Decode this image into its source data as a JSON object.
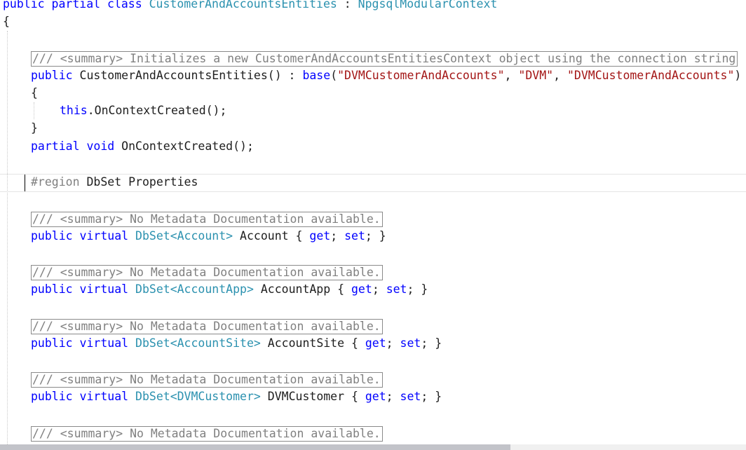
{
  "editor": {
    "lines": {
      "class_decl": {
        "kw1": "public partial class",
        "name": "CustomerAndAccountsEntities",
        "colon": " : ",
        "base": "NpgsqlModularContext"
      },
      "open_brace": "{",
      "ctor_summary": "/// <summary> Initializes a new CustomerAndAccountsEntitiesContext object using the connection string",
      "ctor_decl": {
        "kw": "public",
        "name": " CustomerAndAccountsEntities() : ",
        "base_kw": "base",
        "paren_open": "(",
        "s1": "\"DVMCustomerAndAccounts\"",
        "sep1": ", ",
        "s2": "\"DVM\"",
        "sep2": ", ",
        "s3": "\"DVMCustomerAndAccounts\"",
        "paren_close": ")"
      },
      "ctor_open": "{",
      "ctor_body": {
        "this_kw": "this",
        "rest": ".OnContextCreated();"
      },
      "ctor_close": "}",
      "partial_decl": {
        "kw": "partial void",
        "rest": " OnContextCreated();"
      },
      "region": {
        "kw": "#region",
        "rest": " DbSet Properties"
      },
      "doc_summary": "/// <summary> No Metadata Documentation available.",
      "props": [
        {
          "mods": "public virtual",
          "dbset": "DbSet",
          "lt": "<",
          "entity": "Account",
          "gt": ">",
          "name": " Account ",
          "ob": "{ ",
          "get": "get",
          "semi1": "; ",
          "set": "set",
          "semi2": "; ",
          "cb": "}"
        },
        {
          "mods": "public virtual",
          "dbset": "DbSet",
          "lt": "<",
          "entity": "AccountApp",
          "gt": ">",
          "name": " AccountApp ",
          "ob": "{ ",
          "get": "get",
          "semi1": "; ",
          "set": "set",
          "semi2": "; ",
          "cb": "}"
        },
        {
          "mods": "public virtual",
          "dbset": "DbSet",
          "lt": "<",
          "entity": "AccountSite",
          "gt": ">",
          "name": " AccountSite ",
          "ob": "{ ",
          "get": "get",
          "semi1": "; ",
          "set": "set",
          "semi2": "; ",
          "cb": "}"
        },
        {
          "mods": "public virtual",
          "dbset": "DbSet",
          "lt": "<",
          "entity": "DVMCustomer",
          "gt": ">",
          "name": " DVMCustomer ",
          "ob": "{ ",
          "get": "get",
          "semi1": "; ",
          "set": "set",
          "semi2": "; ",
          "cb": "}"
        }
      ]
    }
  }
}
